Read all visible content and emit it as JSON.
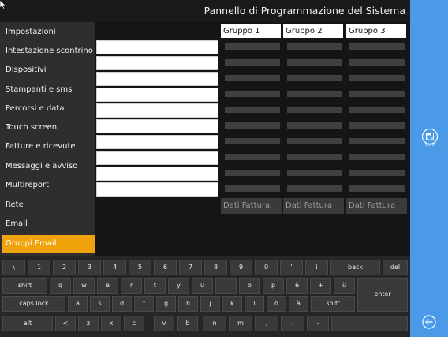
{
  "app": {
    "title": "Pannello di Programmazione del Sistema"
  },
  "sidebar": {
    "items": [
      {
        "label": "Impostazioni"
      },
      {
        "label": "Intestazione scontrino"
      },
      {
        "label": "Dispositivi"
      },
      {
        "label": "Stampanti e sms"
      },
      {
        "label": "Percorsi e data"
      },
      {
        "label": "Touch screen"
      },
      {
        "label": "Fatture e ricevute"
      },
      {
        "label": "Messaggi e avviso"
      },
      {
        "label": "Multireport"
      },
      {
        "label": "Rete"
      },
      {
        "label": "Email"
      },
      {
        "label": "Gruppi Email"
      }
    ],
    "active_index": 11
  },
  "groups": {
    "headers": [
      "Gruppo 1",
      "Gruppo 2",
      "Gruppo 3"
    ],
    "dati_fattura_label": "Dati Fattura"
  },
  "actions": {
    "save_label": "SAVE"
  },
  "keyboard": {
    "row1": [
      "\\",
      "1",
      "2",
      "3",
      "4",
      "5",
      "6",
      "7",
      "8",
      "9",
      "0",
      "'",
      "ì",
      "back",
      "del"
    ],
    "row2": [
      "shift",
      "q",
      "w",
      "e",
      "r",
      "t",
      "y",
      "u",
      "i",
      "o",
      "p",
      "è",
      "+",
      "ù",
      "enter"
    ],
    "row3": [
      "caps lock",
      "a",
      "s",
      "d",
      "f",
      "g",
      "h",
      "j",
      "k",
      "l",
      "ò",
      "à",
      "shift"
    ],
    "row4": [
      "alt",
      "<",
      "z",
      "x",
      "c",
      "v",
      "b",
      "n",
      "m",
      ",",
      ".",
      "-",
      ""
    ]
  },
  "colors": {
    "accent": "#f0a30a",
    "right_bar": "#4a9ae8",
    "background": "#1c1c1c",
    "sidebar": "#2e2e2e"
  },
  "icons": {
    "save": "floppy-disk-icon",
    "back": "back-arrow-circle-icon"
  }
}
